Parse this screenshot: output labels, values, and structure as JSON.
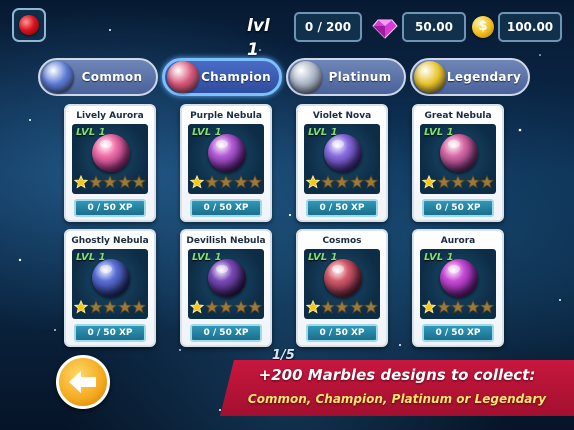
{
  "header": {
    "level_label": "lvl 1",
    "xp": "0 / 200",
    "gems": "50.00",
    "coins": "100.00",
    "coin_symbol": "$"
  },
  "tabs": [
    {
      "label": "Common",
      "color": "#5a7ad6",
      "active": false
    },
    {
      "label": "Champion",
      "color": "#d9567a",
      "active": true
    },
    {
      "label": "Platinum",
      "color": "#a8b4c4",
      "active": false
    },
    {
      "label": "Legendary",
      "color": "#e8c229",
      "active": false
    }
  ],
  "cards": [
    {
      "name": "Lively Aurora",
      "level": "LVL 1",
      "xp": "0 / 50 XP",
      "stars_filled": 1,
      "c1": "#f06fa8",
      "c2": "#7a1a6b"
    },
    {
      "name": "Purple Nebula",
      "level": "LVL 1",
      "xp": "0 / 50 XP",
      "stars_filled": 1,
      "c1": "#b45cd6",
      "c2": "#3a0d5e"
    },
    {
      "name": "Violet Nova",
      "level": "LVL 1",
      "xp": "0 / 50 XP",
      "stars_filled": 1,
      "c1": "#8a6ee0",
      "c2": "#2d1a6b"
    },
    {
      "name": "Great Nebula",
      "level": "LVL 1",
      "xp": "0 / 50 XP",
      "stars_filled": 1,
      "c1": "#d96aa6",
      "c2": "#4a1d5c"
    },
    {
      "name": "Ghostly Nebula",
      "level": "LVL 1",
      "xp": "0 / 50 XP",
      "stars_filled": 1,
      "c1": "#5a6fd6",
      "c2": "#141d52"
    },
    {
      "name": "Devilish Nebula",
      "level": "LVL 1",
      "xp": "0 / 50 XP",
      "stars_filled": 1,
      "c1": "#7a4ab8",
      "c2": "#1d0f3b"
    },
    {
      "name": "Cosmos",
      "level": "LVL 1",
      "xp": "0 / 50 XP",
      "stars_filled": 1,
      "c1": "#d45a6a",
      "c2": "#4a1430"
    },
    {
      "name": "Aurora",
      "level": "LVL 1",
      "xp": "0 / 50 XP",
      "stars_filled": 1,
      "c1": "#c84ad6",
      "c2": "#4c0f6b"
    }
  ],
  "pagination": {
    "current": "1/5"
  },
  "promo": {
    "line1": "+200 Marbles designs to collect:",
    "line2": "Common, Champion, Platinum or Legendary"
  },
  "icons": {
    "top_left": "red-marble-icon",
    "gem": "gem-icon",
    "coin": "coin-icon",
    "back": "back-arrow-icon",
    "star": "star-icon"
  }
}
